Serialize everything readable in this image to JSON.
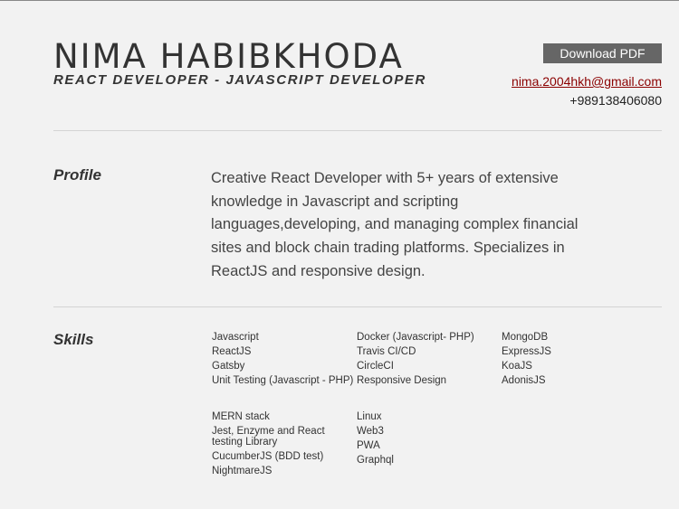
{
  "header": {
    "name": "NIMA HABIBKHODA",
    "tagline": "REACT DEVELOPER - JAVASCRIPT DEVELOPER",
    "download_label": "Download PDF",
    "email": "nima.2004hkh@gmail.com",
    "phone": "+989138406080"
  },
  "profile": {
    "title": "Profile",
    "text": "Creative React Developer with 5+ years of extensive knowledge in Javascript and scripting languages,developing, and managing complex financial sites and block chain trading platforms. Specializes in ReactJS and responsive design."
  },
  "skills": {
    "title": "Skills",
    "group1": {
      "col1": [
        "Javascript",
        "ReactJS",
        "Gatsby",
        "Unit Testing (Javascript - PHP)"
      ],
      "col2": [
        "Docker (Javascript- PHP)",
        "Travis CI/CD",
        "CircleCI",
        "Responsive Design"
      ],
      "col3": [
        "MongoDB",
        "ExpressJS",
        "KoaJS",
        "AdonisJS"
      ]
    },
    "group2": {
      "col1": [
        "MERN stack",
        "Jest, Enzyme and React testing Library",
        "CucumberJS (BDD test)",
        "NightmareJS"
      ],
      "col2": [
        "Linux",
        "Web3",
        "PWA",
        "Graphql"
      ]
    }
  }
}
